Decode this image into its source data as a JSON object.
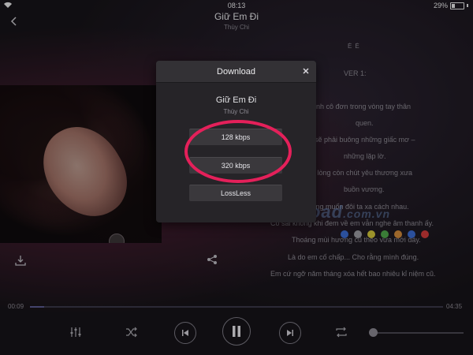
{
  "status_bar": {
    "time": "08:13",
    "battery": "29%"
  },
  "header": {
    "title": "Giữ Em Đi",
    "artist": "Thùy Chi"
  },
  "lyrics": {
    "marker": "ĖĖ",
    "lines": [
      "VER 1:",
      "g thấy mình cô đơn trong vòng tay thân",
      "quen.",
      "o lẽ em sẽ phải buông những giấc mơ –",
      "những lặp lờ.",
      "hi trong lòng còn chút yêu thương xưa",
      "buồn vương.",
      "em không muốn đôi ta xa cách nhau.",
      "Có sai không khi đem về em vẫn nghe âm thanh ấy.",
      "Thoáng mùi hương cũ theo vừa mới đây.",
      "Là do em cố chấp... Cho rằng mình đúng.",
      "Em cứ ngỡ năm tháng xóa hết bao nhiêu kỉ niệm cũ."
    ]
  },
  "watermark": {
    "text": "Download",
    "suffix": ".com.vn"
  },
  "playback": {
    "elapsed": "00:09",
    "duration": "04:35",
    "progress": 0.035,
    "volume": 0.0
  },
  "modal": {
    "title": "Download",
    "song": "Giữ Em Đi",
    "artist": "Thùy Chi",
    "options": [
      "128 kbps",
      "320 kbps",
      "LossLess"
    ]
  },
  "colors": {
    "highlight_ring": "#e4205a",
    "modal_bg": "#262428",
    "dot_colors": [
      "#3a6bd1",
      "#9a9aa0",
      "#d1c43a",
      "#4ea64a",
      "#d18a3a",
      "#3a6bd1",
      "#d13a3a"
    ]
  },
  "icons": [
    "back-chevron",
    "close-x",
    "download",
    "share",
    "equalizer",
    "shuffle",
    "previous",
    "pause",
    "next",
    "repeat"
  ]
}
